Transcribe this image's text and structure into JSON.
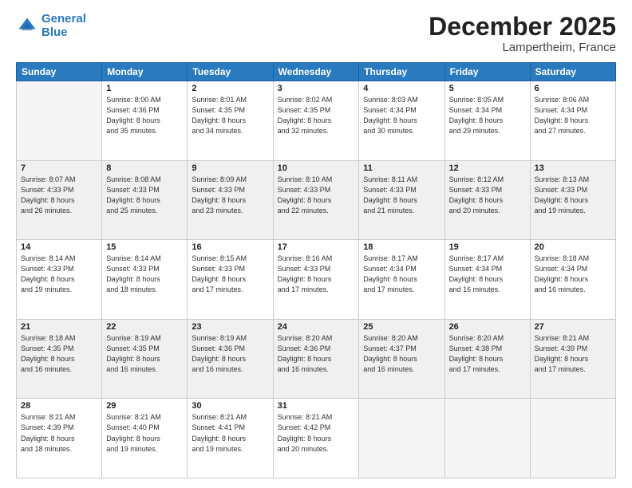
{
  "header": {
    "logo_line1": "General",
    "logo_line2": "Blue",
    "month": "December 2025",
    "location": "Lampertheim, France"
  },
  "days_of_week": [
    "Sunday",
    "Monday",
    "Tuesday",
    "Wednesday",
    "Thursday",
    "Friday",
    "Saturday"
  ],
  "weeks": [
    [
      {
        "num": "",
        "detail": ""
      },
      {
        "num": "1",
        "detail": "Sunrise: 8:00 AM\nSunset: 4:36 PM\nDaylight: 8 hours\nand 35 minutes."
      },
      {
        "num": "2",
        "detail": "Sunrise: 8:01 AM\nSunset: 4:35 PM\nDaylight: 8 hours\nand 34 minutes."
      },
      {
        "num": "3",
        "detail": "Sunrise: 8:02 AM\nSunset: 4:35 PM\nDaylight: 8 hours\nand 32 minutes."
      },
      {
        "num": "4",
        "detail": "Sunrise: 8:03 AM\nSunset: 4:34 PM\nDaylight: 8 hours\nand 30 minutes."
      },
      {
        "num": "5",
        "detail": "Sunrise: 8:05 AM\nSunset: 4:34 PM\nDaylight: 8 hours\nand 29 minutes."
      },
      {
        "num": "6",
        "detail": "Sunrise: 8:06 AM\nSunset: 4:34 PM\nDaylight: 8 hours\nand 27 minutes."
      }
    ],
    [
      {
        "num": "7",
        "detail": "Sunrise: 8:07 AM\nSunset: 4:33 PM\nDaylight: 8 hours\nand 26 minutes."
      },
      {
        "num": "8",
        "detail": "Sunrise: 8:08 AM\nSunset: 4:33 PM\nDaylight: 8 hours\nand 25 minutes."
      },
      {
        "num": "9",
        "detail": "Sunrise: 8:09 AM\nSunset: 4:33 PM\nDaylight: 8 hours\nand 23 minutes."
      },
      {
        "num": "10",
        "detail": "Sunrise: 8:10 AM\nSunset: 4:33 PM\nDaylight: 8 hours\nand 22 minutes."
      },
      {
        "num": "11",
        "detail": "Sunrise: 8:11 AM\nSunset: 4:33 PM\nDaylight: 8 hours\nand 21 minutes."
      },
      {
        "num": "12",
        "detail": "Sunrise: 8:12 AM\nSunset: 4:33 PM\nDaylight: 8 hours\nand 20 minutes."
      },
      {
        "num": "13",
        "detail": "Sunrise: 8:13 AM\nSunset: 4:33 PM\nDaylight: 8 hours\nand 19 minutes."
      }
    ],
    [
      {
        "num": "14",
        "detail": "Sunrise: 8:14 AM\nSunset: 4:33 PM\nDaylight: 8 hours\nand 19 minutes."
      },
      {
        "num": "15",
        "detail": "Sunrise: 8:14 AM\nSunset: 4:33 PM\nDaylight: 8 hours\nand 18 minutes."
      },
      {
        "num": "16",
        "detail": "Sunrise: 8:15 AM\nSunset: 4:33 PM\nDaylight: 8 hours\nand 17 minutes."
      },
      {
        "num": "17",
        "detail": "Sunrise: 8:16 AM\nSunset: 4:33 PM\nDaylight: 8 hours\nand 17 minutes."
      },
      {
        "num": "18",
        "detail": "Sunrise: 8:17 AM\nSunset: 4:34 PM\nDaylight: 8 hours\nand 17 minutes."
      },
      {
        "num": "19",
        "detail": "Sunrise: 8:17 AM\nSunset: 4:34 PM\nDaylight: 8 hours\nand 16 minutes."
      },
      {
        "num": "20",
        "detail": "Sunrise: 8:18 AM\nSunset: 4:34 PM\nDaylight: 8 hours\nand 16 minutes."
      }
    ],
    [
      {
        "num": "21",
        "detail": "Sunrise: 8:18 AM\nSunset: 4:35 PM\nDaylight: 8 hours\nand 16 minutes."
      },
      {
        "num": "22",
        "detail": "Sunrise: 8:19 AM\nSunset: 4:35 PM\nDaylight: 8 hours\nand 16 minutes."
      },
      {
        "num": "23",
        "detail": "Sunrise: 8:19 AM\nSunset: 4:36 PM\nDaylight: 8 hours\nand 16 minutes."
      },
      {
        "num": "24",
        "detail": "Sunrise: 8:20 AM\nSunset: 4:36 PM\nDaylight: 8 hours\nand 16 minutes."
      },
      {
        "num": "25",
        "detail": "Sunrise: 8:20 AM\nSunset: 4:37 PM\nDaylight: 8 hours\nand 16 minutes."
      },
      {
        "num": "26",
        "detail": "Sunrise: 8:20 AM\nSunset: 4:38 PM\nDaylight: 8 hours\nand 17 minutes."
      },
      {
        "num": "27",
        "detail": "Sunrise: 8:21 AM\nSunset: 4:39 PM\nDaylight: 8 hours\nand 17 minutes."
      }
    ],
    [
      {
        "num": "28",
        "detail": "Sunrise: 8:21 AM\nSunset: 4:39 PM\nDaylight: 8 hours\nand 18 minutes."
      },
      {
        "num": "29",
        "detail": "Sunrise: 8:21 AM\nSunset: 4:40 PM\nDaylight: 8 hours\nand 19 minutes."
      },
      {
        "num": "30",
        "detail": "Sunrise: 8:21 AM\nSunset: 4:41 PM\nDaylight: 8 hours\nand 19 minutes."
      },
      {
        "num": "31",
        "detail": "Sunrise: 8:21 AM\nSunset: 4:42 PM\nDaylight: 8 hours\nand 20 minutes."
      },
      {
        "num": "",
        "detail": ""
      },
      {
        "num": "",
        "detail": ""
      },
      {
        "num": "",
        "detail": ""
      }
    ]
  ]
}
